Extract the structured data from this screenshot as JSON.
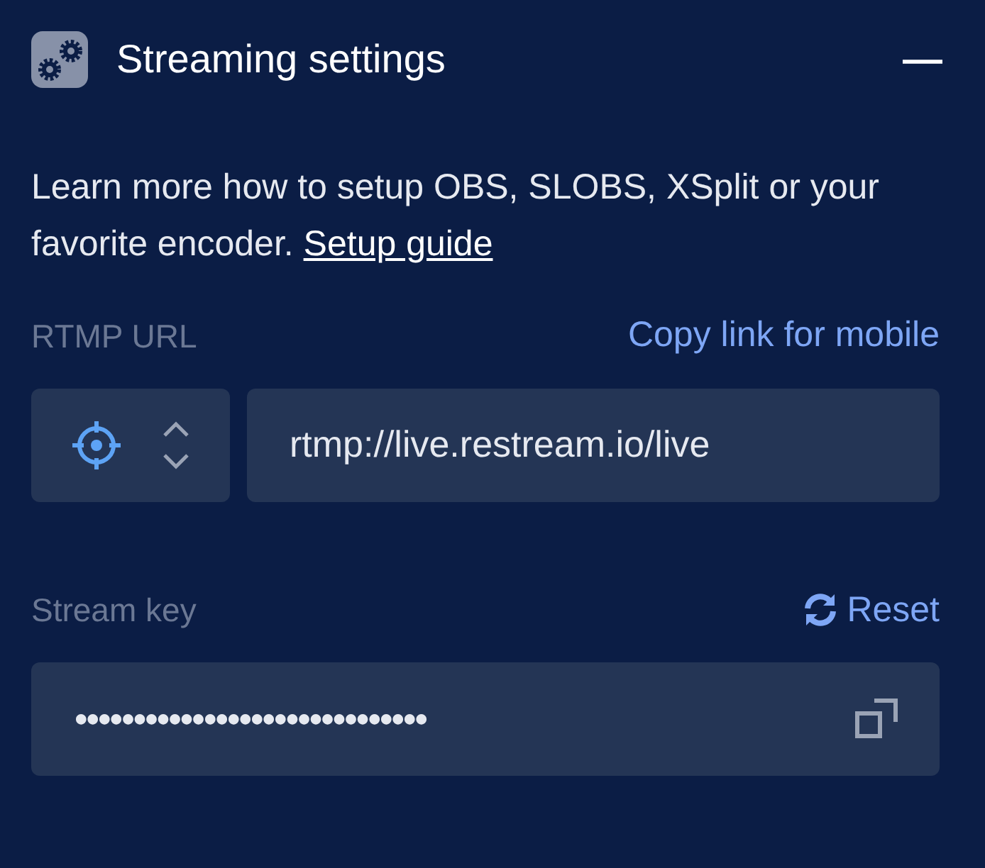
{
  "panel": {
    "title": "Streaming settings",
    "collapse_symbol": "—"
  },
  "intro": {
    "text": "Learn more how to setup OBS, SLOBS, XSplit or your favorite encoder.",
    "link": "Setup guide"
  },
  "rtmp": {
    "label": "RTMP URL",
    "action": "Copy link for mobile",
    "value": "rtmp://live.restream.io/live"
  },
  "stream_key": {
    "label": "Stream key",
    "action": "Reset",
    "value": "●●●●●●●●●●●●●●●●●●●●●●●●●●●●●●"
  }
}
